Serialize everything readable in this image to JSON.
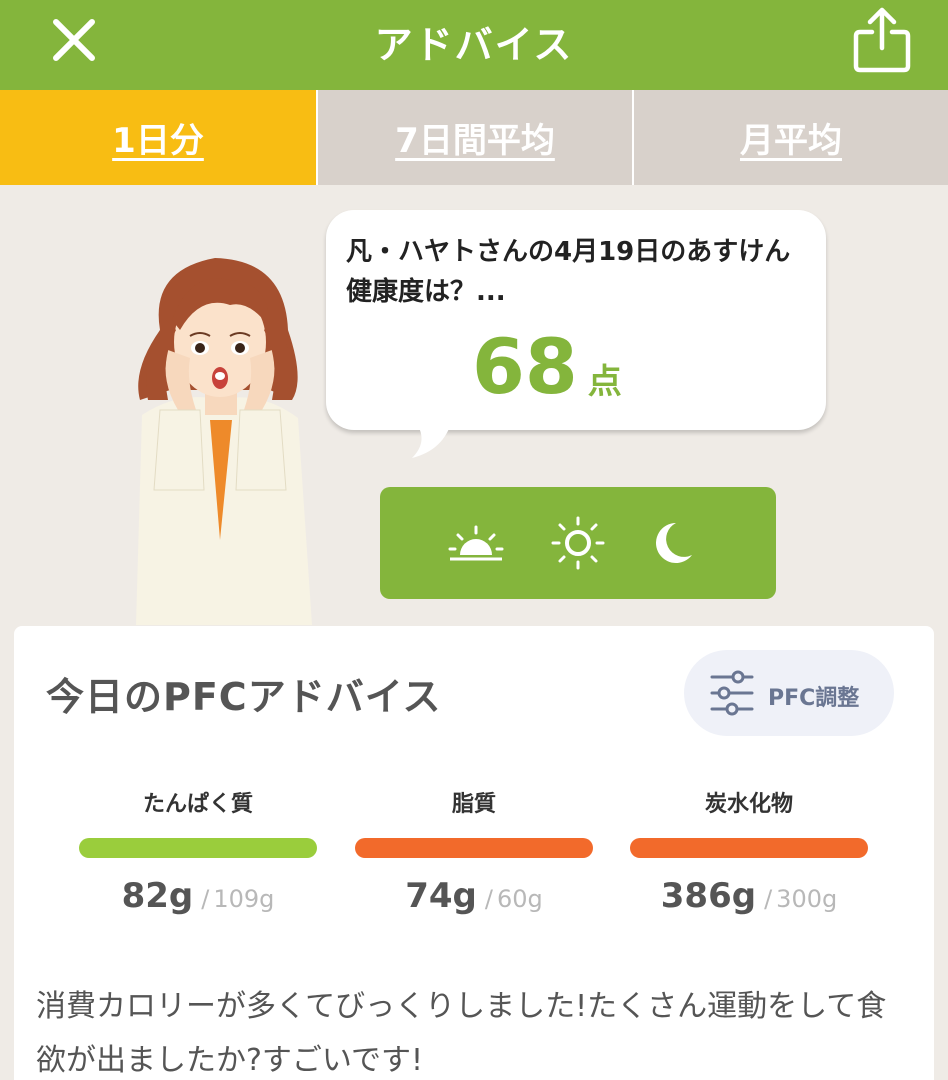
{
  "header": {
    "title": "アドバイス"
  },
  "tabs": [
    {
      "label": "1日分",
      "active": true
    },
    {
      "label": "7日間平均",
      "active": false
    },
    {
      "label": "月平均",
      "active": false
    }
  ],
  "bubble": {
    "message": "凡・ハヤトさんの4月19日のあすけん健康度は？...",
    "score": "68",
    "score_unit": "点"
  },
  "time_icons": [
    "sunrise-icon",
    "sun-icon",
    "moon-icon"
  ],
  "pfc": {
    "title": "今日のPFCアドバイス",
    "adjust_label": "PFC調整",
    "nutrients": [
      {
        "name": "たんぱく質",
        "value": "82g",
        "target": "109g",
        "color": "#9acd3c"
      },
      {
        "name": "脂質",
        "value": "74g",
        "target": "60g",
        "color": "#f26a2b"
      },
      {
        "name": "炭水化物",
        "value": "386g",
        "target": "300g",
        "color": "#f26a2b"
      }
    ],
    "separator": "/",
    "advice": "消費カロリーが多くてびっくりしました!たくさん運動をして食欲が出ましたか?すごいです!"
  },
  "colors": {
    "header_green": "#84b53c",
    "tab_active": "#f8bd13",
    "tab_inactive": "#d8d1cb",
    "background": "#efebe6"
  }
}
